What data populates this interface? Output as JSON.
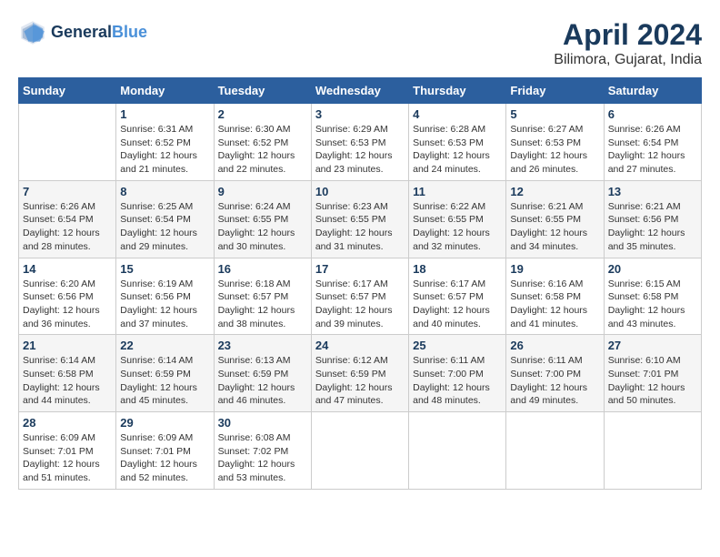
{
  "header": {
    "logo_line1": "General",
    "logo_line2": "Blue",
    "month_title": "April 2024",
    "location": "Bilimora, Gujarat, India"
  },
  "calendar": {
    "days_of_week": [
      "Sunday",
      "Monday",
      "Tuesday",
      "Wednesday",
      "Thursday",
      "Friday",
      "Saturday"
    ],
    "weeks": [
      [
        {
          "day": "",
          "info": ""
        },
        {
          "day": "1",
          "info": "Sunrise: 6:31 AM\nSunset: 6:52 PM\nDaylight: 12 hours\nand 21 minutes."
        },
        {
          "day": "2",
          "info": "Sunrise: 6:30 AM\nSunset: 6:52 PM\nDaylight: 12 hours\nand 22 minutes."
        },
        {
          "day": "3",
          "info": "Sunrise: 6:29 AM\nSunset: 6:53 PM\nDaylight: 12 hours\nand 23 minutes."
        },
        {
          "day": "4",
          "info": "Sunrise: 6:28 AM\nSunset: 6:53 PM\nDaylight: 12 hours\nand 24 minutes."
        },
        {
          "day": "5",
          "info": "Sunrise: 6:27 AM\nSunset: 6:53 PM\nDaylight: 12 hours\nand 26 minutes."
        },
        {
          "day": "6",
          "info": "Sunrise: 6:26 AM\nSunset: 6:54 PM\nDaylight: 12 hours\nand 27 minutes."
        }
      ],
      [
        {
          "day": "7",
          "info": "Sunrise: 6:26 AM\nSunset: 6:54 PM\nDaylight: 12 hours\nand 28 minutes."
        },
        {
          "day": "8",
          "info": "Sunrise: 6:25 AM\nSunset: 6:54 PM\nDaylight: 12 hours\nand 29 minutes."
        },
        {
          "day": "9",
          "info": "Sunrise: 6:24 AM\nSunset: 6:55 PM\nDaylight: 12 hours\nand 30 minutes."
        },
        {
          "day": "10",
          "info": "Sunrise: 6:23 AM\nSunset: 6:55 PM\nDaylight: 12 hours\nand 31 minutes."
        },
        {
          "day": "11",
          "info": "Sunrise: 6:22 AM\nSunset: 6:55 PM\nDaylight: 12 hours\nand 32 minutes."
        },
        {
          "day": "12",
          "info": "Sunrise: 6:21 AM\nSunset: 6:55 PM\nDaylight: 12 hours\nand 34 minutes."
        },
        {
          "day": "13",
          "info": "Sunrise: 6:21 AM\nSunset: 6:56 PM\nDaylight: 12 hours\nand 35 minutes."
        }
      ],
      [
        {
          "day": "14",
          "info": "Sunrise: 6:20 AM\nSunset: 6:56 PM\nDaylight: 12 hours\nand 36 minutes."
        },
        {
          "day": "15",
          "info": "Sunrise: 6:19 AM\nSunset: 6:56 PM\nDaylight: 12 hours\nand 37 minutes."
        },
        {
          "day": "16",
          "info": "Sunrise: 6:18 AM\nSunset: 6:57 PM\nDaylight: 12 hours\nand 38 minutes."
        },
        {
          "day": "17",
          "info": "Sunrise: 6:17 AM\nSunset: 6:57 PM\nDaylight: 12 hours\nand 39 minutes."
        },
        {
          "day": "18",
          "info": "Sunrise: 6:17 AM\nSunset: 6:57 PM\nDaylight: 12 hours\nand 40 minutes."
        },
        {
          "day": "19",
          "info": "Sunrise: 6:16 AM\nSunset: 6:58 PM\nDaylight: 12 hours\nand 41 minutes."
        },
        {
          "day": "20",
          "info": "Sunrise: 6:15 AM\nSunset: 6:58 PM\nDaylight: 12 hours\nand 43 minutes."
        }
      ],
      [
        {
          "day": "21",
          "info": "Sunrise: 6:14 AM\nSunset: 6:58 PM\nDaylight: 12 hours\nand 44 minutes."
        },
        {
          "day": "22",
          "info": "Sunrise: 6:14 AM\nSunset: 6:59 PM\nDaylight: 12 hours\nand 45 minutes."
        },
        {
          "day": "23",
          "info": "Sunrise: 6:13 AM\nSunset: 6:59 PM\nDaylight: 12 hours\nand 46 minutes."
        },
        {
          "day": "24",
          "info": "Sunrise: 6:12 AM\nSunset: 6:59 PM\nDaylight: 12 hours\nand 47 minutes."
        },
        {
          "day": "25",
          "info": "Sunrise: 6:11 AM\nSunset: 7:00 PM\nDaylight: 12 hours\nand 48 minutes."
        },
        {
          "day": "26",
          "info": "Sunrise: 6:11 AM\nSunset: 7:00 PM\nDaylight: 12 hours\nand 49 minutes."
        },
        {
          "day": "27",
          "info": "Sunrise: 6:10 AM\nSunset: 7:01 PM\nDaylight: 12 hours\nand 50 minutes."
        }
      ],
      [
        {
          "day": "28",
          "info": "Sunrise: 6:09 AM\nSunset: 7:01 PM\nDaylight: 12 hours\nand 51 minutes."
        },
        {
          "day": "29",
          "info": "Sunrise: 6:09 AM\nSunset: 7:01 PM\nDaylight: 12 hours\nand 52 minutes."
        },
        {
          "day": "30",
          "info": "Sunrise: 6:08 AM\nSunset: 7:02 PM\nDaylight: 12 hours\nand 53 minutes."
        },
        {
          "day": "",
          "info": ""
        },
        {
          "day": "",
          "info": ""
        },
        {
          "day": "",
          "info": ""
        },
        {
          "day": "",
          "info": ""
        }
      ]
    ]
  }
}
